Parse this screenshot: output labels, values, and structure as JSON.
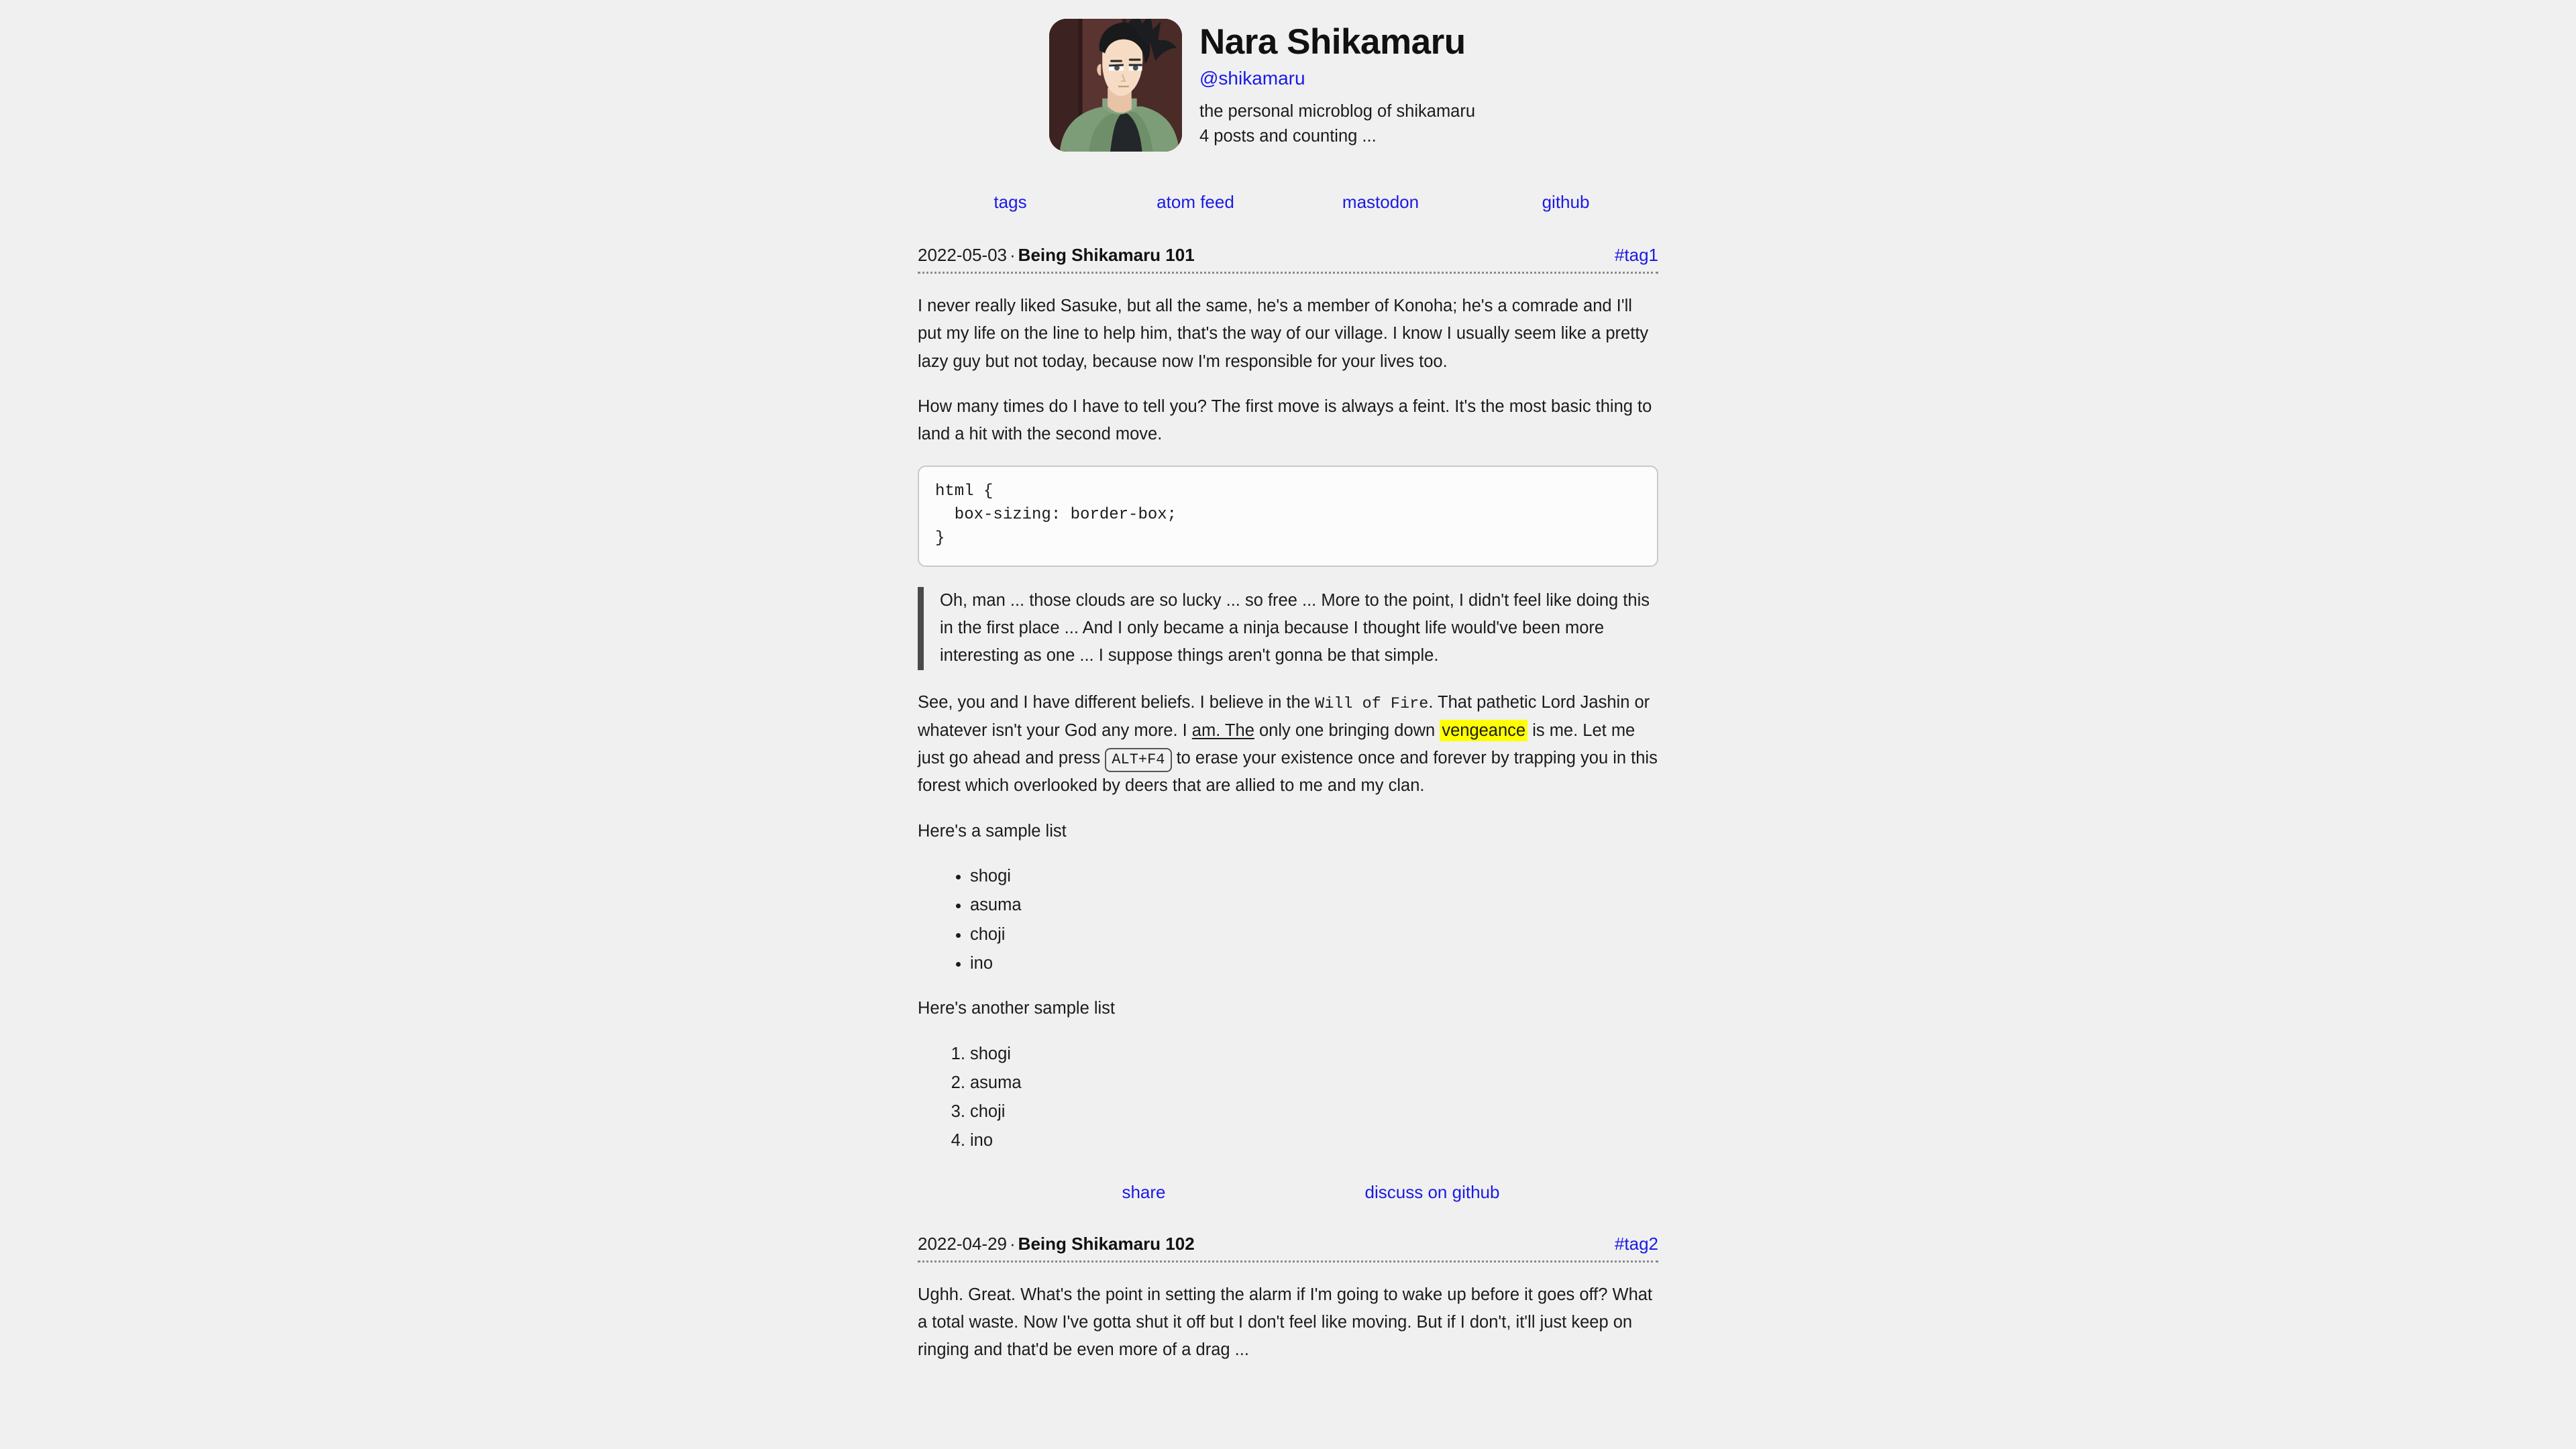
{
  "theme": {
    "background": "#f0f0f0",
    "text": "#1b1b1b",
    "link": "#1a1ae6",
    "highlight": "#ffff00",
    "quote_bar": "#4a4a4a",
    "code_bg": "#fcfcfc",
    "code_border": "#c9c9c9",
    "rule": "#8a8a8a"
  },
  "profile": {
    "name": "Nara Shikamaru",
    "handle": "@shikamaru",
    "tagline": "the personal microblog of shikamaru",
    "post_count": "4 posts and counting ...",
    "avatar_alt": "shikamaru-avatar"
  },
  "nav": {
    "items": [
      {
        "label": "tags",
        "name": "nav-link-tags"
      },
      {
        "label": "atom feed",
        "name": "nav-link-atom-feed"
      },
      {
        "label": "mastodon",
        "name": "nav-link-mastodon"
      },
      {
        "label": "github",
        "name": "nav-link-github"
      }
    ]
  },
  "posts": [
    {
      "date": "2022-05-03",
      "separator": "·",
      "title": "Being Shikamaru 101",
      "tag": "#tag1",
      "paragraph_1": "I never really liked Sasuke, but all the same, he's a member of Konoha; he's a comrade and I'll put my life on the line to help him, that's the way of our village. I know I usually seem like a pretty lazy guy but not today, because now I'm responsible for your lives too.",
      "paragraph_2": "How many times do I have to tell you? The first move is always a feint. It's the most basic thing to land a hit with the second move.",
      "code": "html {\n  box-sizing: border-box;\n}",
      "quote": "Oh, man ... those clouds are so lucky ... so free ... More to the point, I didn't feel like doing this in the first place ... And I only became a ninja because I thought life would've been more interesting as one ... I suppose things aren't gonna be that simple.",
      "rich_paragraph": {
        "part_1": "See, you and I have different beliefs. I believe in the ",
        "inline_code": "Will of Fire",
        "part_2": ". That pathetic Lord Jashin or whatever isn't your God any more. I ",
        "underlined": "am. The",
        "part_3": " only one bringing down ",
        "highlight": "vengeance",
        "part_4": " is me. Let me just go ahead and press ",
        "kbd": "ALT+F4",
        "part_5": " to erase your existence once and forever by trapping you in this forest which overlooked by deers that are allied to me and my clan."
      },
      "list_1_intro": "Here's a sample list",
      "list_1": [
        "shogi",
        "asuma",
        "choji",
        "ino"
      ],
      "list_2_intro": "Here's another sample list",
      "list_2": [
        "shogi",
        "asuma",
        "choji",
        "ino"
      ],
      "footer_links": [
        {
          "label": "share",
          "name": "post-share-link"
        },
        {
          "label": "discuss on github",
          "name": "post-discuss-link"
        }
      ]
    },
    {
      "date": "2022-04-29",
      "separator": "·",
      "title": "Being Shikamaru 102",
      "tag": "#tag2",
      "paragraph_1": "Ughh. Great. What's the point in setting the alarm if I'm going to wake up before it goes off? What a total waste. Now I've gotta shut it off but I don't feel like moving. But if I don't, it'll just keep on ringing and that'd be even more of a drag ..."
    }
  ]
}
